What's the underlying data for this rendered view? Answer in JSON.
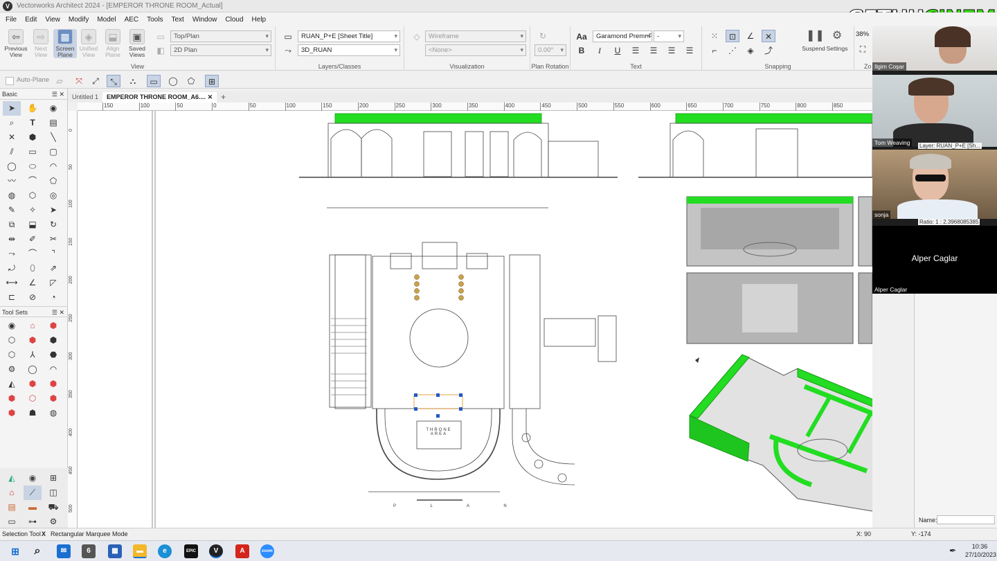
{
  "window": {
    "title": "Vectorworks Architect 2024 - [EMPEROR THRONE ROOM_Actual]"
  },
  "menu": [
    "File",
    "Edit",
    "View",
    "Modify",
    "Model",
    "AEC",
    "Tools",
    "Text",
    "Window",
    "Cloud",
    "Help"
  ],
  "ribbon": {
    "view": {
      "label": "View",
      "buttons": [
        {
          "label": "Previous View",
          "icon": "arrow-left-icon"
        },
        {
          "label": "Next View",
          "icon": "arrow-right-icon"
        },
        {
          "label": "Screen Plane",
          "icon": "screen-plane-icon"
        },
        {
          "label": "Unified View",
          "icon": "unified-view-icon"
        },
        {
          "label": "Align Plane",
          "icon": "align-plane-icon"
        },
        {
          "label": "Saved Views",
          "icon": "saved-views-icon"
        }
      ],
      "plane": "Top/Plan",
      "projection": "2D Plan"
    },
    "layers": {
      "label": "Layers/Classes",
      "layer": "RUAN_P+E [Sheet Title]",
      "class": "3D_RUAN"
    },
    "visualization": {
      "label": "Visualization",
      "render": "Wireframe",
      "option": "<None>"
    },
    "rotation": {
      "label": "Plan Rotation",
      "value": "0.00°"
    },
    "text": {
      "label": "Text",
      "font": "Garamond Premr P",
      "size": "-"
    },
    "snapping": {
      "label": "Snapping",
      "suspend": "Suspend",
      "settings": "Settings"
    },
    "zoom": {
      "value": "38%",
      "label": "Zo"
    }
  },
  "toolbar2": {
    "auto_plane": "Auto-Plane"
  },
  "palettes": {
    "basic": "Basic",
    "toolsets": "Tool Sets"
  },
  "doc_tabs": [
    "Untitled 1",
    "EMPEROR THRONE ROOM_A6...."
  ],
  "ruler": {
    "h_labels": [
      "150",
      "100",
      "50",
      "0",
      "50",
      "100",
      "150",
      "200",
      "250",
      "300",
      "350",
      "400",
      "450",
      "500",
      "550",
      "600",
      "650",
      "700",
      "750",
      "800",
      "850"
    ],
    "v_labels": [
      "0",
      "50",
      "100",
      "150",
      "200",
      "250",
      "300",
      "350",
      "400",
      "450",
      "500"
    ]
  },
  "drawing": {
    "plan_title": "P L A N",
    "throne_label": "THRONE AREA"
  },
  "video": {
    "participants": [
      {
        "name": "Ilgim Coşar"
      },
      {
        "name": "Tom Weaving"
      },
      {
        "name": "sonja"
      },
      {
        "name": "Alper Caglar",
        "overlay": "Alper Caglar"
      }
    ],
    "overlay_layer": "Layer: RUAN_P+E [Sh...",
    "overlay_ratio": "Ratio: 1 : 2.3968085385"
  },
  "right_panel": {
    "name_label": "Name:"
  },
  "status": {
    "tool": "Selection Tool",
    "mode": "Rectangular Marquee Mode",
    "x": "X: 90",
    "y": "Y: -174"
  },
  "taskbar": {
    "time": "10:36",
    "date": "27/10/2023"
  },
  "watermark": {
    "part1": "GETHU",
    "part2": "CINEMA",
    "color1": "#ffffff",
    "color2": "#3ddc1a"
  },
  "colors": {
    "highlight": "#22dd22",
    "accent": "#2f6fc7"
  }
}
